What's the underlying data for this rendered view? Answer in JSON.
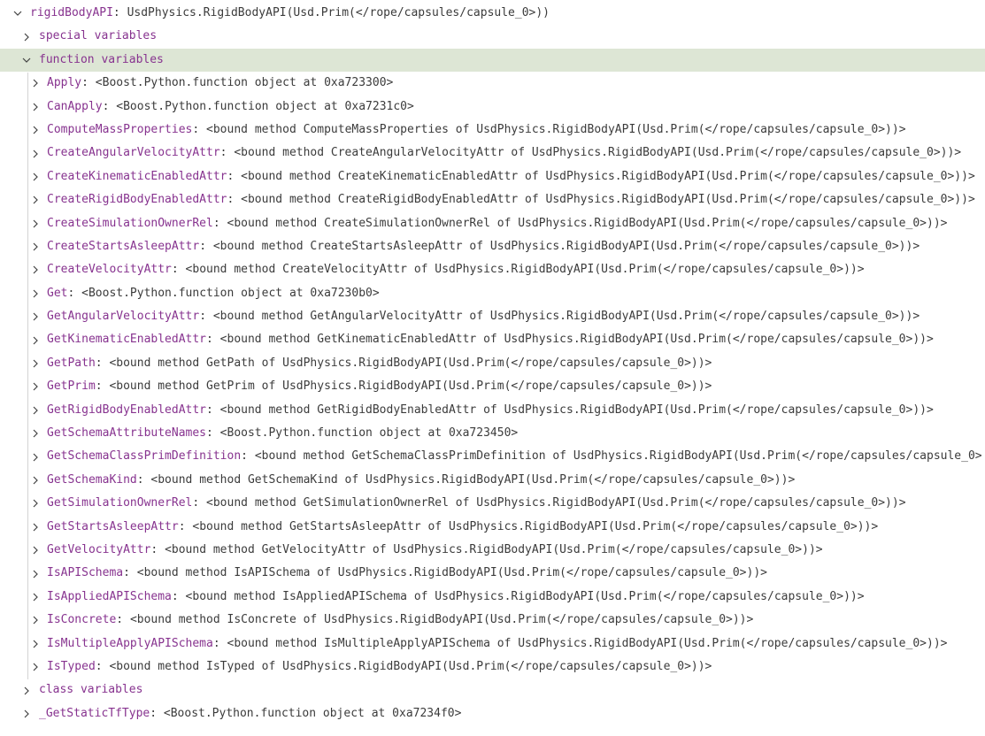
{
  "tree": {
    "root": {
      "name": "rigidBodyAPI",
      "value": "UsdPhysics.RigidBodyAPI(Usd.Prim(</rope/capsules/capsule_0>))",
      "expanded": true
    },
    "groups": {
      "special": {
        "label": "special variables",
        "expanded": false
      },
      "function": {
        "label": "function variables",
        "expanded": true
      },
      "class": {
        "label": "class variables",
        "expanded": false
      }
    },
    "function_items": [
      {
        "name": "Apply",
        "value": "<Boost.Python.function object at 0xa723300>"
      },
      {
        "name": "CanApply",
        "value": "<Boost.Python.function object at 0xa7231c0>"
      },
      {
        "name": "ComputeMassProperties",
        "value": "<bound method ComputeMassProperties of UsdPhysics.RigidBodyAPI(Usd.Prim(</rope/capsules/capsule_0>))>"
      },
      {
        "name": "CreateAngularVelocityAttr",
        "value": "<bound method CreateAngularVelocityAttr of UsdPhysics.RigidBodyAPI(Usd.Prim(</rope/capsules/capsule_0>))>"
      },
      {
        "name": "CreateKinematicEnabledAttr",
        "value": "<bound method CreateKinematicEnabledAttr of UsdPhysics.RigidBodyAPI(Usd.Prim(</rope/capsules/capsule_0>))>"
      },
      {
        "name": "CreateRigidBodyEnabledAttr",
        "value": "<bound method CreateRigidBodyEnabledAttr of UsdPhysics.RigidBodyAPI(Usd.Prim(</rope/capsules/capsule_0>))>"
      },
      {
        "name": "CreateSimulationOwnerRel",
        "value": "<bound method CreateSimulationOwnerRel of UsdPhysics.RigidBodyAPI(Usd.Prim(</rope/capsules/capsule_0>))>"
      },
      {
        "name": "CreateStartsAsleepAttr",
        "value": "<bound method CreateStartsAsleepAttr of UsdPhysics.RigidBodyAPI(Usd.Prim(</rope/capsules/capsule_0>))>"
      },
      {
        "name": "CreateVelocityAttr",
        "value": "<bound method CreateVelocityAttr of UsdPhysics.RigidBodyAPI(Usd.Prim(</rope/capsules/capsule_0>))>"
      },
      {
        "name": "Get",
        "value": "<Boost.Python.function object at 0xa7230b0>"
      },
      {
        "name": "GetAngularVelocityAttr",
        "value": "<bound method GetAngularVelocityAttr of UsdPhysics.RigidBodyAPI(Usd.Prim(</rope/capsules/capsule_0>))>"
      },
      {
        "name": "GetKinematicEnabledAttr",
        "value": "<bound method GetKinematicEnabledAttr of UsdPhysics.RigidBodyAPI(Usd.Prim(</rope/capsules/capsule_0>))>"
      },
      {
        "name": "GetPath",
        "value": "<bound method GetPath of UsdPhysics.RigidBodyAPI(Usd.Prim(</rope/capsules/capsule_0>))>"
      },
      {
        "name": "GetPrim",
        "value": "<bound method GetPrim of UsdPhysics.RigidBodyAPI(Usd.Prim(</rope/capsules/capsule_0>))>"
      },
      {
        "name": "GetRigidBodyEnabledAttr",
        "value": "<bound method GetRigidBodyEnabledAttr of UsdPhysics.RigidBodyAPI(Usd.Prim(</rope/capsules/capsule_0>))>"
      },
      {
        "name": "GetSchemaAttributeNames",
        "value": "<Boost.Python.function object at 0xa723450>"
      },
      {
        "name": "GetSchemaClassPrimDefinition",
        "value": "<bound method GetSchemaClassPrimDefinition of UsdPhysics.RigidBodyAPI(Usd.Prim(</rope/capsules/capsule_0>"
      },
      {
        "name": "GetSchemaKind",
        "value": "<bound method GetSchemaKind of UsdPhysics.RigidBodyAPI(Usd.Prim(</rope/capsules/capsule_0>))>"
      },
      {
        "name": "GetSimulationOwnerRel",
        "value": "<bound method GetSimulationOwnerRel of UsdPhysics.RigidBodyAPI(Usd.Prim(</rope/capsules/capsule_0>))>"
      },
      {
        "name": "GetStartsAsleepAttr",
        "value": "<bound method GetStartsAsleepAttr of UsdPhysics.RigidBodyAPI(Usd.Prim(</rope/capsules/capsule_0>))>"
      },
      {
        "name": "GetVelocityAttr",
        "value": "<bound method GetVelocityAttr of UsdPhysics.RigidBodyAPI(Usd.Prim(</rope/capsules/capsule_0>))>"
      },
      {
        "name": "IsAPISchema",
        "value": "<bound method IsAPISchema of UsdPhysics.RigidBodyAPI(Usd.Prim(</rope/capsules/capsule_0>))>"
      },
      {
        "name": "IsAppliedAPISchema",
        "value": "<bound method IsAppliedAPISchema of UsdPhysics.RigidBodyAPI(Usd.Prim(</rope/capsules/capsule_0>))>"
      },
      {
        "name": "IsConcrete",
        "value": "<bound method IsConcrete of UsdPhysics.RigidBodyAPI(Usd.Prim(</rope/capsules/capsule_0>))>"
      },
      {
        "name": "IsMultipleApplyAPISchema",
        "value": "<bound method IsMultipleApplyAPISchema of UsdPhysics.RigidBodyAPI(Usd.Prim(</rope/capsules/capsule_0>))>"
      },
      {
        "name": "IsTyped",
        "value": "<bound method IsTyped of UsdPhysics.RigidBodyAPI(Usd.Prim(</rope/capsules/capsule_0>))>"
      }
    ],
    "trailing_item": {
      "name": "_GetStaticTfType",
      "value": "<Boost.Python.function object at 0xa7234f0>"
    }
  },
  "icons": {
    "expanded": "chevron-down-icon",
    "collapsed": "chevron-right-icon"
  },
  "colors": {
    "variable_name": "#87338f",
    "value_text": "#3b3b3b",
    "selection_bg": "#dde6d5",
    "indent_guide": "#d4d4d4"
  }
}
